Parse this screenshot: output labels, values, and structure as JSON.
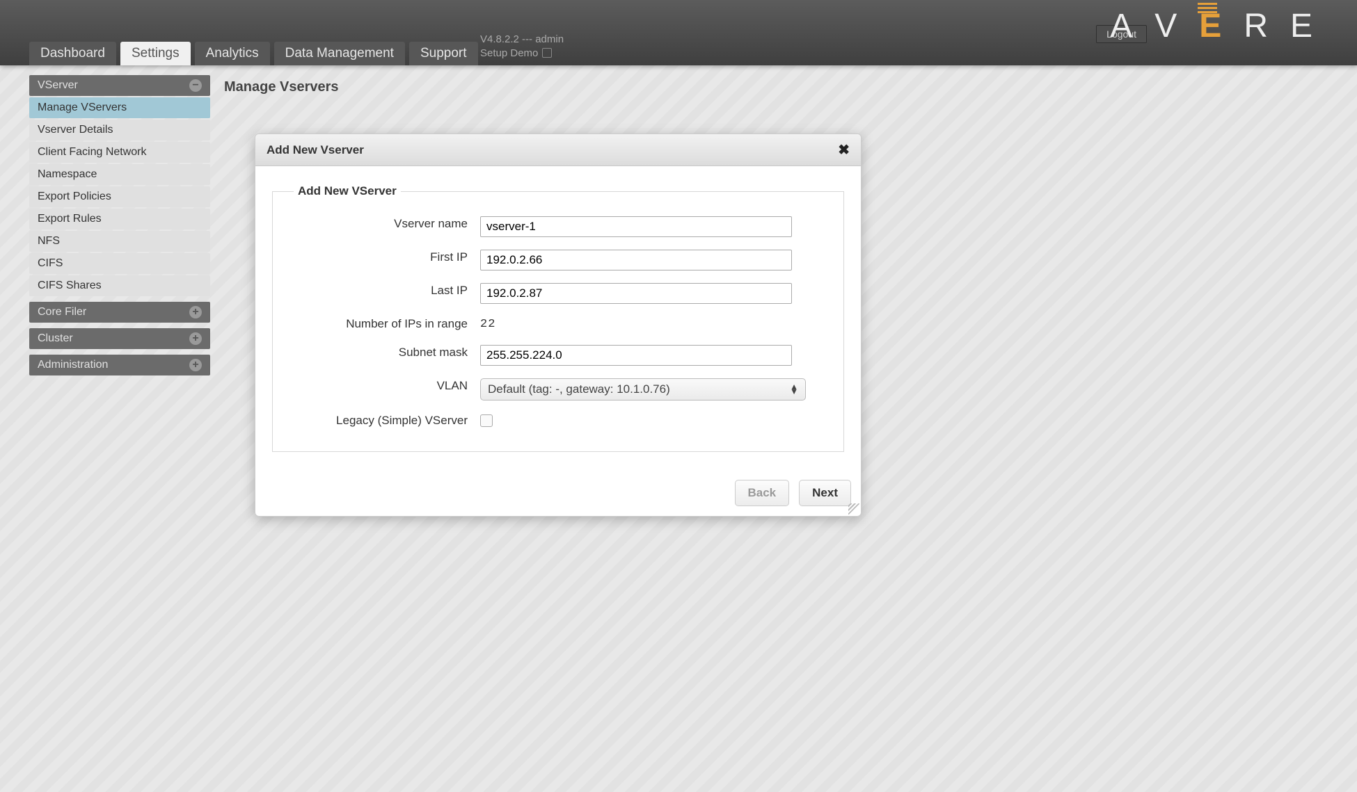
{
  "header": {
    "logout": "Logout",
    "logo_letters": {
      "a": "A",
      "v": "V",
      "e": "E",
      "r": "R",
      "e2": "E"
    },
    "tabs": [
      "Dashboard",
      "Settings",
      "Analytics",
      "Data Management",
      "Support"
    ],
    "active_tab_index": 1,
    "meta_line1": "V4.8.2.2 --- admin",
    "meta_line2": "Setup Demo"
  },
  "sidebar": {
    "sections": [
      {
        "title": "VServer",
        "expanded": true,
        "items": [
          "Manage VServers",
          "Vserver Details",
          "Client Facing Network",
          "Namespace",
          "Export Policies",
          "Export Rules",
          "NFS",
          "CIFS",
          "CIFS Shares"
        ],
        "selected_index": 0
      },
      {
        "title": "Core Filer",
        "expanded": false
      },
      {
        "title": "Cluster",
        "expanded": false
      },
      {
        "title": "Administration",
        "expanded": false
      }
    ]
  },
  "page": {
    "title": "Manage Vservers"
  },
  "dialog": {
    "title": "Add New Vserver",
    "legend": "Add New VServer",
    "labels": {
      "vserver_name": "Vserver name",
      "first_ip": "First IP",
      "last_ip": "Last IP",
      "ip_count": "Number of IPs in range",
      "subnet": "Subnet mask",
      "vlan": "VLAN",
      "legacy": "Legacy (Simple) VServer"
    },
    "values": {
      "vserver_name": "vserver-1",
      "first_ip": "192.0.2.66",
      "last_ip": "192.0.2.87",
      "ip_count": "22",
      "subnet": "255.255.224.0",
      "vlan_selected": "Default (tag: -, gateway: 10.1.0.76)",
      "legacy_checked": false
    },
    "buttons": {
      "back": "Back",
      "next": "Next"
    }
  }
}
